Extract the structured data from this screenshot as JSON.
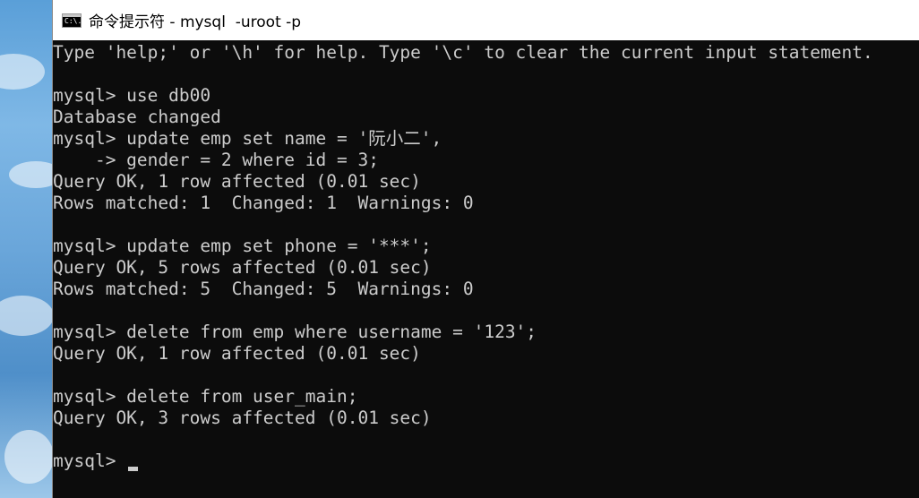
{
  "window": {
    "title": "命令提示符 - mysql  -uroot -p",
    "icon": "console-icon",
    "icon_glyph": "C:\\."
  },
  "console": {
    "lines": [
      "Type 'help;' or '\\h' for help. Type '\\c' to clear the current input statement.",
      "",
      "mysql> use db00",
      "Database changed",
      "mysql> update emp set name = '阮小二',",
      "    -> gender = 2 where id = 3;",
      "Query OK, 1 row affected (0.01 sec)",
      "Rows matched: 1  Changed: 1  Warnings: 0",
      "",
      "mysql> update emp set phone = '***';",
      "Query OK, 5 rows affected (0.01 sec)",
      "Rows matched: 5  Changed: 5  Warnings: 0",
      "",
      "mysql> delete from emp where username = '123';",
      "Query OK, 1 row affected (0.01 sec)",
      "",
      "mysql> delete from user_main;",
      "Query OK, 3 rows affected (0.01 sec)",
      ""
    ],
    "prompt": "mysql> "
  },
  "colors": {
    "console_bg": "#0c0c0c",
    "console_fg": "#cccccc",
    "titlebar_bg": "#ffffff"
  }
}
